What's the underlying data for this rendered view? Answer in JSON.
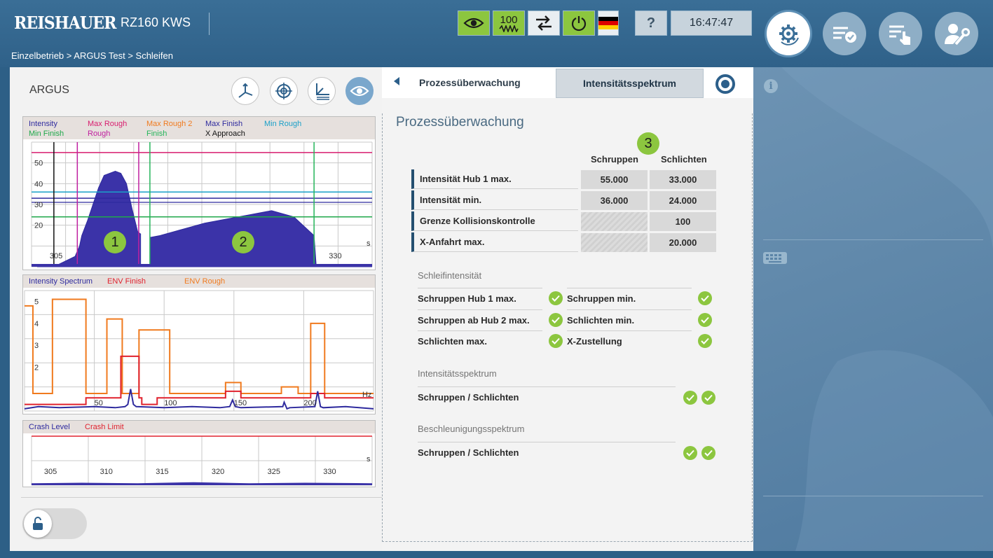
{
  "header": {
    "logo": "REISHAUER",
    "machine": "RZ160 KWS",
    "breadcrumb": "Einzelbetrieb > ARGUS Test > Schleifen",
    "speed_value": "100",
    "clock": "16:47:47",
    "help": "?",
    "icons": [
      "eye-icon",
      "speed-100-icon",
      "swap-arrows-icon",
      "power-icon",
      "german-flag-icon",
      "help-icon"
    ],
    "nav_icons": [
      "gear-cycle-icon",
      "list-check-icon",
      "list-touch-icon",
      "user-wrench-icon"
    ]
  },
  "argus": {
    "title": "ARGUS",
    "tool_icons": [
      "axis-icon",
      "target-icon",
      "axis-chart-icon",
      "eye-icon"
    ],
    "badges": [
      "1",
      "2"
    ]
  },
  "panel": {
    "tabs": [
      "Prozessüberwachung",
      "Intensitätsspektrum"
    ],
    "title": "Prozessüberwachung",
    "badge": "3",
    "col_headers": [
      "Schruppen",
      "Schlichten"
    ],
    "params": [
      {
        "label": "Intensität Hub 1 max.",
        "schruppen": "55.000",
        "schlichten": "33.000"
      },
      {
        "label": "Intensität min.",
        "schruppen": "36.000",
        "schlichten": "24.000"
      },
      {
        "label": "Grenze Kollisionskontrolle",
        "schruppen": "",
        "schlichten": "100"
      },
      {
        "label": "X-Anfahrt max.",
        "schruppen": "",
        "schlichten": "20.000"
      }
    ],
    "schleif_title": "Schleifintensität",
    "schleif_left": [
      "Schruppen Hub 1 max.",
      "Schruppen ab Hub 2 max.",
      "Schlichten max."
    ],
    "schleif_right": [
      "Schruppen min.",
      "Schlichten min.",
      "X-Zustellung"
    ],
    "spektrum_title": "Intensitätsspektrum",
    "spektrum_row": "Schruppen / Schlichten",
    "beschl_title": "Beschleunigungsspektrum",
    "beschl_row": "Schruppen / Schlichten",
    "colors": {
      "ok": "#8cc63f",
      "accent": "#244f70"
    }
  },
  "chart_data": [
    {
      "type": "area",
      "legend": [
        "Intensity",
        "Max Rough",
        "Max Rough 2",
        "Max Finish",
        "Min Rough",
        "Min Finish",
        "Rough",
        "Finish",
        "X Approach"
      ],
      "legend_colors": [
        "#2e2a9e",
        "#d81c6e",
        "#f07a1e",
        "#2e2a9e",
        "#1aa0c8",
        "#1fa84a",
        "#c020a0",
        "#25b55a",
        "#111111"
      ],
      "y_ticks": [
        "50",
        "40",
        "30",
        "20"
      ],
      "x_ticks": [
        "305",
        "330"
      ],
      "x_unit": "s",
      "ylim": [
        0,
        60
      ],
      "xlim": [
        303.5,
        334
      ],
      "thresholds": [
        {
          "name": "Max Rough",
          "y": 55
        },
        {
          "name": "Min Rough",
          "y": 36
        },
        {
          "name": "Max Finish",
          "y": 33
        },
        {
          "name": "Min Finish",
          "y": 24
        }
      ],
      "markers": [
        {
          "name": "X Approach",
          "x": 305.5
        },
        {
          "name": "Rough",
          "x": 307.6
        },
        {
          "name": "Rough",
          "x": 313.1
        },
        {
          "name": "Finish",
          "x": 314.1
        },
        {
          "name": "Finish",
          "x": 328.8
        }
      ],
      "series": [
        {
          "name": "Intensity",
          "x": [
            304,
            305.5,
            307.4,
            307.8,
            308,
            308.5,
            309,
            309.5,
            310,
            311,
            311.5,
            312,
            312.5,
            313,
            313.2,
            314,
            315,
            317,
            319,
            321,
            323,
            325,
            327,
            328,
            328.8,
            329,
            334
          ],
          "y": [
            0,
            0,
            5,
            10,
            15,
            22,
            30,
            38,
            44,
            46,
            45,
            40,
            28,
            17,
            16,
            14,
            15,
            18,
            21,
            23,
            25,
            27,
            24,
            19,
            15,
            0,
            0
          ]
        }
      ]
    },
    {
      "type": "line",
      "legend": [
        "Intensity Spectrum",
        "ENV Finish",
        "ENV Rough"
      ],
      "legend_colors": [
        "#2e2a9e",
        "#e0222e",
        "#f07a1e"
      ],
      "y_ticks": [
        "5",
        "4",
        "3",
        "2"
      ],
      "x_ticks": [
        "50",
        "100",
        "150",
        "200"
      ],
      "x_unit": "Hz",
      "ylim": [
        0,
        5.5
      ],
      "xlim": [
        0,
        250
      ],
      "series": [
        {
          "name": "ENV Rough",
          "x": [
            0,
            6,
            6,
            20,
            20,
            44,
            44,
            59,
            59,
            70,
            70,
            82,
            82,
            104,
            104,
            144,
            144,
            155,
            155,
            184,
            184,
            196,
            196,
            205,
            205,
            215,
            215,
            250
          ],
          "y": [
            4.8,
            4.8,
            0.8,
            0.8,
            5.1,
            5.1,
            0.8,
            0.8,
            4.2,
            4.2,
            0.8,
            0.8,
            3.7,
            3.7,
            0.8,
            0.8,
            1.3,
            1.3,
            0.8,
            0.8,
            1.1,
            1.1,
            0.8,
            0.8,
            4,
            4,
            0.8,
            0.8
          ]
        },
        {
          "name": "ENV Finish",
          "x": [
            0,
            44,
            44,
            69,
            69,
            82,
            82,
            84,
            84,
            95,
            95,
            144,
            144,
            155,
            155,
            205,
            205,
            215,
            215,
            250
          ],
          "y": [
            0.3,
            0.3,
            0.6,
            0.6,
            2.5,
            2.5,
            0.6,
            0.6,
            0.3,
            0.3,
            0.6,
            0.6,
            0.9,
            0.9,
            0.6,
            0.6,
            0.8,
            0.8,
            0.6,
            0.6
          ]
        },
        {
          "name": "Intensity Spectrum",
          "x": [
            0,
            10,
            25,
            50,
            65,
            72,
            74,
            76,
            78,
            80,
            100,
            120,
            140,
            147,
            149,
            151,
            155,
            185,
            186,
            188,
            190,
            208,
            210,
            212,
            214,
            230,
            250
          ],
          "y": [
            0.1,
            0.2,
            0.15,
            0.2,
            0.15,
            0.2,
            0.3,
            1,
            0.3,
            0.2,
            0.15,
            0.2,
            0.15,
            0.2,
            0.5,
            0.2,
            0.15,
            0.2,
            0.4,
            0.1,
            0.15,
            0.2,
            0.9,
            0.2,
            0.15,
            0.2,
            0.1
          ]
        }
      ]
    },
    {
      "type": "area",
      "legend": [
        "Crash Level",
        "Crash Limit"
      ],
      "legend_colors": [
        "#2e2a9e",
        "#e0222e"
      ],
      "x_ticks": [
        "305",
        "310",
        "315",
        "320",
        "325",
        "330"
      ],
      "x_unit": "s",
      "ylim": [
        0,
        100
      ],
      "xlim": [
        303.5,
        334
      ],
      "limit": 100,
      "series": [
        {
          "name": "Crash Level",
          "x": [
            303.5,
            308,
            313,
            318,
            323,
            328,
            334
          ],
          "y": [
            4,
            5,
            4,
            6,
            4,
            5,
            4
          ]
        }
      ]
    }
  ]
}
